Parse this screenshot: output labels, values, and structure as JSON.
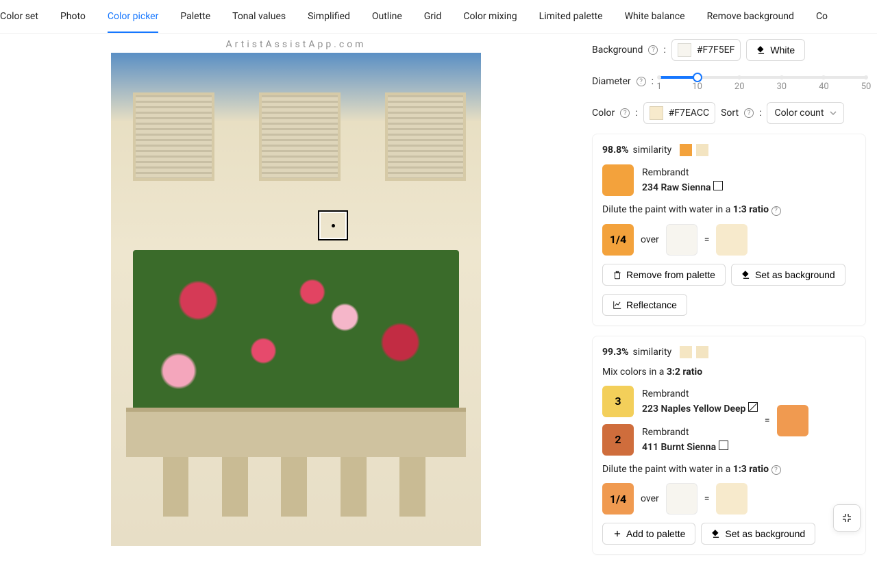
{
  "watermark": "ArtistAssistApp.com",
  "tabs": [
    "Color set",
    "Photo",
    "Color picker",
    "Palette",
    "Tonal values",
    "Simplified",
    "Outline",
    "Grid",
    "Color mixing",
    "Limited palette",
    "White balance",
    "Remove background",
    "Co"
  ],
  "activeTab": "Color picker",
  "background": {
    "label": "Background",
    "hex": "#F7F5EF",
    "whiteBtn": "White"
  },
  "diameter": {
    "label": "Diameter",
    "marks": [
      "1",
      "10",
      "20",
      "30",
      "40",
      "50"
    ],
    "value": 10
  },
  "color": {
    "label": "Color",
    "hex": "#F7EACC"
  },
  "sort": {
    "label": "Sort",
    "value": "Color count"
  },
  "cards": [
    {
      "similarity": "98.8%",
      "simLabel": "similarity",
      "swA": "#f3a23c",
      "swB": "#f3e4c1",
      "paints": [
        {
          "brand": "Rembrandt",
          "name": "234 Raw Sienna",
          "color": "#f3a23c",
          "icon": "square"
        }
      ],
      "diluteText": "Dilute the paint with water in a ",
      "diluteRatio": "1:3 ratio",
      "ratioBox": "1/4",
      "ratioColor": "#f3a23c",
      "over": "over",
      "bg": "#f7f5ef",
      "eq": "=",
      "result": "#f7eacc",
      "buttons": {
        "remove": "Remove from palette",
        "setbg": "Set as background",
        "reflect": "Reflectance"
      }
    },
    {
      "similarity": "99.3%",
      "simLabel": "similarity",
      "swA": "#f5e6c3",
      "swB": "#f3e4c1",
      "mixText": "Mix colors in a ",
      "mixRatio": "3:2 ratio",
      "mixPaints": [
        {
          "num": "3",
          "numColor": "#f3cf5a",
          "brand": "Rembrandt",
          "name": "223 Naples Yellow Deep",
          "icon": "diag"
        },
        {
          "num": "2",
          "numColor": "#cf6d3c",
          "brand": "Rembrandt",
          "name": "411 Burnt Sienna",
          "icon": "square"
        }
      ],
      "mixEq": "=",
      "mixResult": "#f09a50",
      "diluteText": "Dilute the paint with water in a ",
      "diluteRatio": "1:3 ratio",
      "ratioBox": "1/4",
      "ratioColor": "#f09a50",
      "over": "over",
      "bg": "#f7f5ef",
      "eq": "=",
      "result": "#f7eacc",
      "buttons": {
        "add": "Add to palette",
        "setbg": "Set as background"
      }
    }
  ]
}
